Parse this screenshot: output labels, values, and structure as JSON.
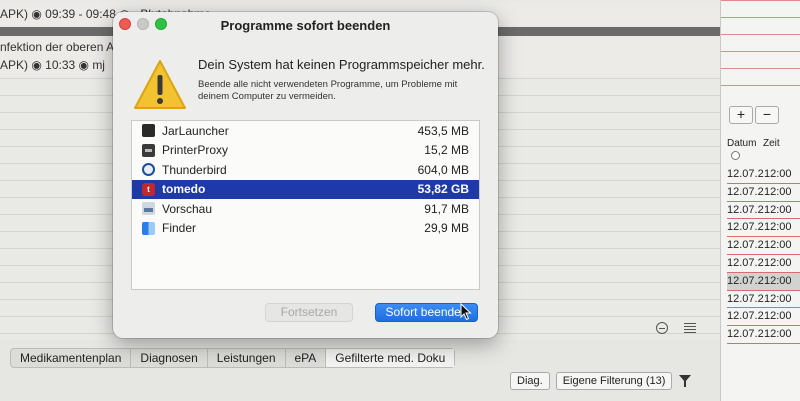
{
  "background": {
    "row1_text": "APK) ◉ 09:39 - 09:48 ◉ · Blutabnahme · ...",
    "row2_text": "nfektion der oberen A",
    "row3_text": "APK) ◉ 10:33 ◉ mj",
    "tabs": [
      {
        "label": "Medikamentenplan"
      },
      {
        "label": "Diagnosen"
      },
      {
        "label": "Leistungen"
      },
      {
        "label": "ePA"
      },
      {
        "label": "Gefilterte med. Doku"
      }
    ],
    "filter_diag": "Diag.",
    "filter_custom": "Eigene Filterung (13)"
  },
  "right_panel": {
    "btn_add": "+",
    "btn_remove": "−",
    "col_date": "Datum",
    "col_time": "Zeit",
    "rows": [
      {
        "date": "12.07.2",
        "time": "12:00"
      },
      {
        "date": "12.07.2",
        "time": "12:00"
      },
      {
        "date": "12.07.2",
        "time": "12:00"
      },
      {
        "date": "12.07.2",
        "time": "12:00"
      },
      {
        "date": "12.07.2",
        "time": "12:00"
      },
      {
        "date": "12.07.2",
        "time": "12:00"
      },
      {
        "date": "12.07.2",
        "time": "12:00"
      },
      {
        "date": "12.07.2",
        "time": "12:00"
      },
      {
        "date": "12.07.2",
        "time": "12:00"
      },
      {
        "date": "12.07.2",
        "time": "12:00"
      }
    ],
    "highlight_row_index": 6
  },
  "dialog": {
    "title": "Programme sofort beenden",
    "message_title": "Dein System hat keinen Programmspeicher mehr.",
    "message_text": "Beende alle nicht verwendeten Programme, um Probleme mit deinem Computer zu vermeiden.",
    "apps": [
      {
        "name": "JarLauncher",
        "size": "453,5 MB",
        "icon": "jar-launcher-icon"
      },
      {
        "name": "PrinterProxy",
        "size": "15,2 MB",
        "icon": "printer-proxy-icon"
      },
      {
        "name": "Thunderbird",
        "size": "604,0 MB",
        "icon": "thunderbird-icon"
      },
      {
        "name": "tomedo",
        "size": "53,82 GB",
        "icon": "tomedo-icon",
        "selected": true
      },
      {
        "name": "Vorschau",
        "size": "91,7 MB",
        "icon": "preview-icon"
      },
      {
        "name": "Finder",
        "size": "29,9 MB",
        "icon": "finder-icon"
      }
    ],
    "btn_continue": "Fortsetzen",
    "btn_quit": "Sofort beenden",
    "accent_color": "#1e3aa8"
  }
}
